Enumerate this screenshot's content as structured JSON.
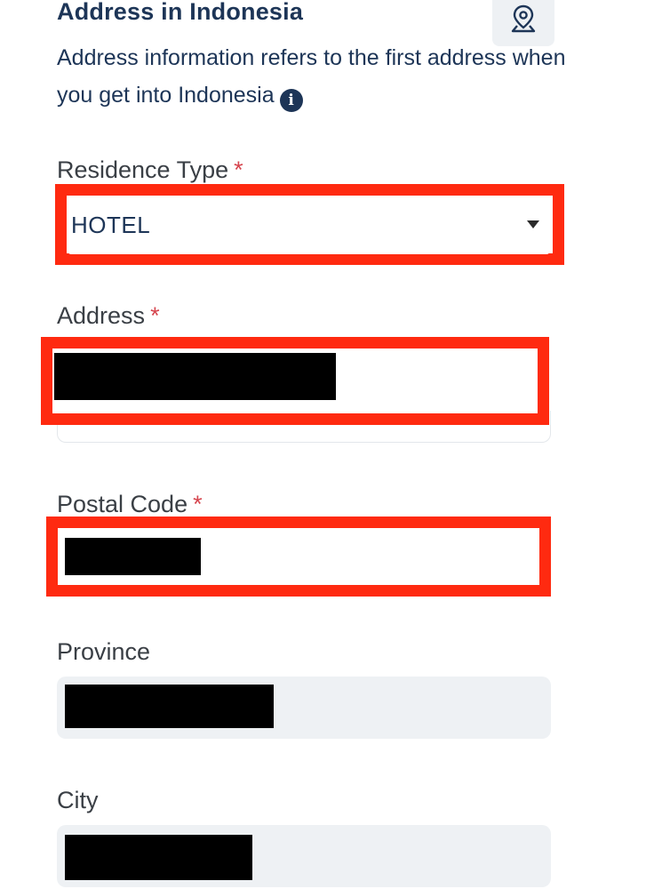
{
  "section": {
    "title": "Address in Indonesia",
    "description": "Address information refers to the first address when you get into Indonesia",
    "info_icon_glyph": "i",
    "map_icon": "map-pin-icon"
  },
  "fields": {
    "residence_type": {
      "label": "Residence Type",
      "required_mark": "*",
      "value": "HOTEL"
    },
    "address": {
      "label": "Address",
      "required_mark": "*",
      "value": "[redacted]"
    },
    "postal_code": {
      "label": "Postal Code",
      "required_mark": "*",
      "value": "[redacted]"
    },
    "province": {
      "label": "Province",
      "value": "[redacted]"
    },
    "city": {
      "label": "City",
      "value": "[redacted]"
    }
  },
  "colors": {
    "text_primary": "#1d3557",
    "required": "#d6454e",
    "highlight": "#ff2a10",
    "readonly_bg": "#eef1f4"
  }
}
